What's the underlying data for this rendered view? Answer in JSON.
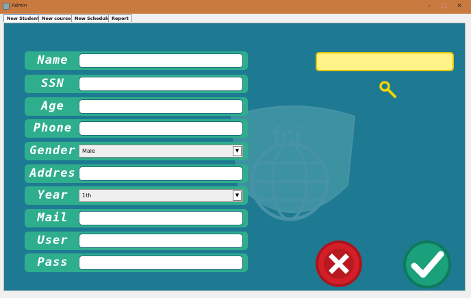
{
  "window": {
    "title": "Admin",
    "minimize": "–",
    "maximize": "□",
    "close": "✕"
  },
  "tabs": [
    {
      "label": "New Student",
      "active": true
    },
    {
      "label": "New course",
      "active": false
    },
    {
      "label": "New Schedule",
      "active": false
    },
    {
      "label": "Report",
      "active": false
    }
  ],
  "form": {
    "fields": [
      {
        "label": "Name",
        "value": ""
      },
      {
        "label": "SSN",
        "value": ""
      },
      {
        "label": "Age",
        "value": ""
      },
      {
        "label": "Phone",
        "value": ""
      },
      {
        "label": "Gender",
        "value": "Male",
        "type": "select"
      },
      {
        "label": "Addres",
        "value": ""
      },
      {
        "label": "Year",
        "value": "1th",
        "type": "select"
      },
      {
        "label": "Mail",
        "value": ""
      },
      {
        "label": "User",
        "value": ""
      },
      {
        "label": "Pass",
        "value": ""
      }
    ],
    "dropdown_arrow": "▼"
  },
  "search": {
    "value": ""
  },
  "colors": {
    "panel": "#1e7a92",
    "label_bg": "#2fae8d",
    "search_bg": "#fff388",
    "cancel": "#d51f28",
    "ok": "#1aa07a",
    "titlebar": "#c97a3e"
  },
  "icons": {
    "search": "search-icon",
    "cancel": "x-icon",
    "ok": "check-icon"
  }
}
